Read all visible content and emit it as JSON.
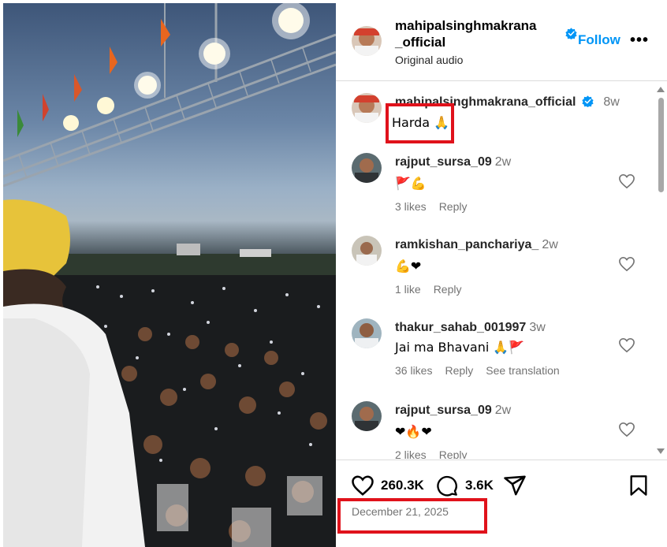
{
  "post": {
    "username": "mahipalsinghmakrana_official",
    "follow_label": "Follow",
    "more_label": "•••",
    "audio_label": "Original audio"
  },
  "caption": {
    "username": "mahipalsinghmakrana_official",
    "time": "8w",
    "text": "Harda 🙏"
  },
  "comments": [
    {
      "username": "rajput_sursa_09",
      "time": "2w",
      "text": "🚩💪",
      "likes": "3 likes",
      "reply": "Reply",
      "translate": ""
    },
    {
      "username": "ramkishan_panchariya_",
      "time": "2w",
      "text": "💪❤",
      "likes": "1 like",
      "reply": "Reply",
      "translate": ""
    },
    {
      "username": "thakur_sahab_001997",
      "time": "3w",
      "text": "Jai ma Bhavani 🙏🚩",
      "likes": "36 likes",
      "reply": "Reply",
      "translate": "See translation"
    },
    {
      "username": "rajput_sursa_09",
      "time": "2w",
      "text": "❤🔥❤",
      "likes": "2 likes",
      "reply": "Reply",
      "translate": ""
    }
  ],
  "actions": {
    "like_count": "260.3K",
    "comment_count": "3.6K"
  },
  "date": "December 21, 2025",
  "colors": {
    "accent": "#0095f6",
    "highlight": "#e0121b"
  }
}
